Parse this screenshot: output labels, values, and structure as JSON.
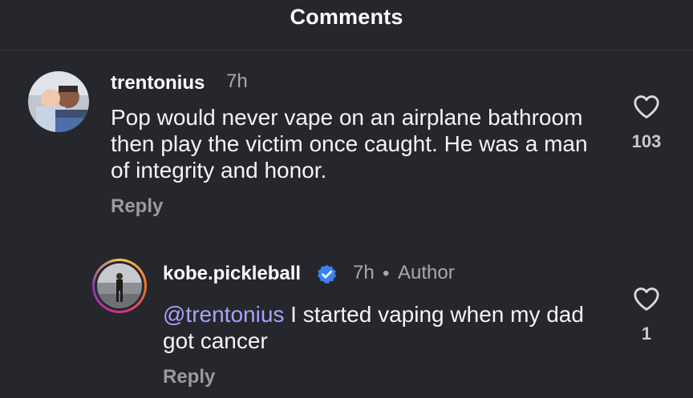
{
  "header": {
    "title": "Comments"
  },
  "comments": [
    {
      "username": "trentonius",
      "time": "7h",
      "text": "Pop would never vape on an airplane bathroom then play the victim once caught. He was a man of integrity and honor.",
      "reply_label": "Reply",
      "likes": "103",
      "like_icon": "heart-outline-icon"
    },
    {
      "username": "kobe.pickleball",
      "verified_icon": "verified-badge-icon",
      "time": "7h",
      "separator": "•",
      "author_label": "Author",
      "mention": "@trentonius",
      "text": " I started vaping when my dad got cancer",
      "reply_label": "Reply",
      "likes": "1",
      "like_icon": "heart-outline-icon"
    }
  ],
  "colors": {
    "background": "#25272c",
    "mention": "#a9a3f5",
    "verified": "#3b82f6"
  }
}
